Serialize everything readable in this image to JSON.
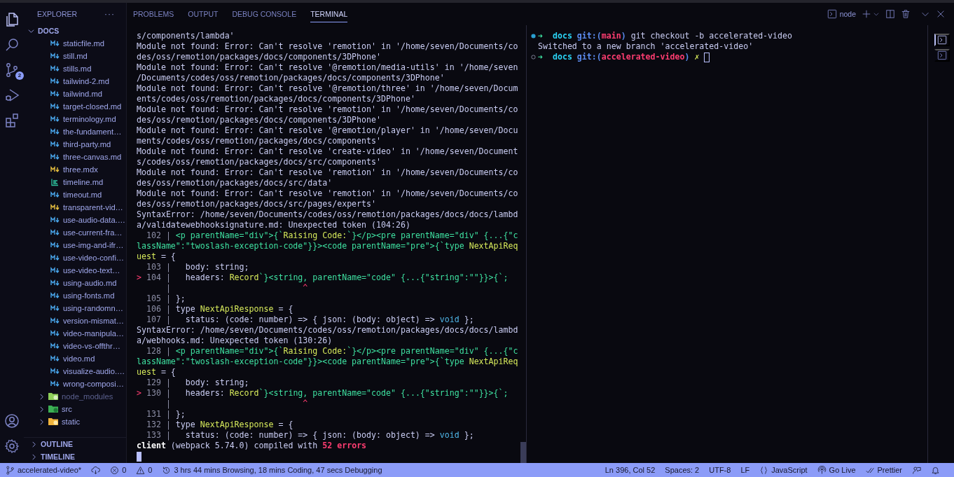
{
  "activity_bar": {
    "items": [
      {
        "kind": "files",
        "selected": true
      },
      {
        "kind": "search",
        "selected": false
      },
      {
        "kind": "source-control",
        "selected": false,
        "badge": "2"
      },
      {
        "kind": "run-debug",
        "selected": false
      },
      {
        "kind": "extensions",
        "selected": false
      }
    ],
    "bottom": [
      {
        "kind": "account"
      },
      {
        "kind": "settings"
      }
    ]
  },
  "explorer": {
    "title": "EXPLORER",
    "actions": "···",
    "tree": {
      "label": "DOCS",
      "expanded": true,
      "children": [
        {
          "kind": "md",
          "label": "staticfile.md"
        },
        {
          "kind": "md",
          "label": "still.md"
        },
        {
          "kind": "md",
          "label": "stills.md"
        },
        {
          "kind": "md",
          "label": "tailwind-2.md"
        },
        {
          "kind": "md",
          "label": "tailwind.md"
        },
        {
          "kind": "md",
          "label": "target-closed.md"
        },
        {
          "kind": "md",
          "label": "terminology.md"
        },
        {
          "kind": "md",
          "label": "the-fundament…"
        },
        {
          "kind": "md",
          "label": "third-party.md"
        },
        {
          "kind": "md",
          "label": "three-canvas.md"
        },
        {
          "kind": "mdx",
          "label": "three.mdx"
        },
        {
          "kind": "timeline",
          "label": "timeline.md"
        },
        {
          "kind": "md",
          "label": "timeout.md"
        },
        {
          "kind": "mdx",
          "label": "transparent-vid…"
        },
        {
          "kind": "md",
          "label": "use-audio-data.…"
        },
        {
          "kind": "md",
          "label": "use-current-fra…"
        },
        {
          "kind": "md",
          "label": "use-img-and-ifr…"
        },
        {
          "kind": "md",
          "label": "use-video-confi…"
        },
        {
          "kind": "md",
          "label": "use-video-text…"
        },
        {
          "kind": "md",
          "label": "using-audio.md"
        },
        {
          "kind": "md",
          "label": "using-fonts.md"
        },
        {
          "kind": "md",
          "label": "using-randomn…"
        },
        {
          "kind": "md",
          "label": "version-mismat…"
        },
        {
          "kind": "md",
          "label": "video-manipula…"
        },
        {
          "kind": "md",
          "label": "video-vs-offthr…"
        },
        {
          "kind": "md",
          "label": "video.md"
        },
        {
          "kind": "md",
          "label": "visualize-audio.…"
        },
        {
          "kind": "md",
          "label": "wrong-composi…"
        },
        {
          "kind": "folder-node",
          "label": "node_modules",
          "expanded": false,
          "dimmed": true
        },
        {
          "kind": "folder-src",
          "label": "src",
          "expanded": false,
          "dimmed": false
        },
        {
          "kind": "folder-static",
          "label": "static",
          "expanded": false,
          "dimmed": false
        }
      ]
    },
    "sections": [
      {
        "label": "OUTLINE",
        "expanded": false
      },
      {
        "label": "TIMELINE",
        "expanded": false
      }
    ]
  },
  "panel": {
    "tabs": [
      {
        "label": "PROBLEMS",
        "selected": false
      },
      {
        "label": "OUTPUT",
        "selected": false
      },
      {
        "label": "DEBUG CONSOLE",
        "selected": false
      },
      {
        "label": "TERMINAL",
        "selected": true
      }
    ],
    "terminal_name": "node",
    "left_terminal": {
      "cursor": true,
      "lines": [
        {
          "segments": [
            {
              "text": "s/components/lambda'",
              "kind": "plain"
            }
          ]
        },
        {
          "segments": [
            {
              "text": "Module not found: Error: Can't resolve 'remotion' in '/home/seven/Documents/co",
              "kind": "plain"
            }
          ]
        },
        {
          "segments": [
            {
              "text": "des/oss/remotion/packages/docs/components/3DPhone'",
              "kind": "plain"
            }
          ]
        },
        {
          "segments": [
            {
              "text": "Module not found: Error: Can't resolve '@remotion/media-utils' in '/home/seven",
              "kind": "plain"
            }
          ]
        },
        {
          "segments": [
            {
              "text": "/Documents/codes/oss/remotion/packages/docs/components/3DPhone'",
              "kind": "plain"
            }
          ]
        },
        {
          "segments": [
            {
              "text": "Module not found: Error: Can't resolve '@remotion/three' in '/home/seven/Docum",
              "kind": "plain"
            }
          ]
        },
        {
          "segments": [
            {
              "text": "ents/codes/oss/remotion/packages/docs/components/3DPhone'",
              "kind": "plain"
            }
          ]
        },
        {
          "segments": [
            {
              "text": "Module not found: Error: Can't resolve 'remotion' in '/home/seven/Documents/co",
              "kind": "plain"
            }
          ]
        },
        {
          "segments": [
            {
              "text": "des/oss/remotion/packages/docs/components/3DPhone'",
              "kind": "plain"
            }
          ]
        },
        {
          "segments": [
            {
              "text": "Module not found: Error: Can't resolve '@remotion/player' in '/home/seven/Docu",
              "kind": "plain"
            }
          ]
        },
        {
          "segments": [
            {
              "text": "ments/codes/oss/remotion/packages/docs/components'",
              "kind": "plain"
            }
          ]
        },
        {
          "segments": [
            {
              "text": "Module not found: Error: Can't resolve 'create-video' in '/home/seven/Document",
              "kind": "plain"
            }
          ]
        },
        {
          "segments": [
            {
              "text": "s/codes/oss/remotion/packages/docs/src/components'",
              "kind": "plain"
            }
          ]
        },
        {
          "segments": [
            {
              "text": "Module not found: Error: Can't resolve 'remotion' in '/home/seven/Documents/co",
              "kind": "plain"
            }
          ]
        },
        {
          "segments": [
            {
              "text": "des/oss/remotion/packages/docs/src/data'",
              "kind": "plain"
            }
          ]
        },
        {
          "segments": [
            {
              "text": "Module not found: Error: Can't resolve 'remotion' in '/home/seven/Documents/co",
              "kind": "plain"
            }
          ]
        },
        {
          "segments": [
            {
              "text": "des/oss/remotion/packages/docs/src/pages/experts'",
              "kind": "plain"
            }
          ]
        },
        {
          "segments": [
            {
              "text": "SyntaxError: /home/seven/Documents/codes/oss/remotion/packages/docs/docs/lambd",
              "kind": "plain"
            }
          ]
        },
        {
          "segments": [
            {
              "text": "a/validatewebhooksignature.md: Unexpected token (104:26)",
              "kind": "plain"
            }
          ]
        },
        {
          "segments": [
            {
              "text": "  102 | ",
              "kind": "num"
            },
            {
              "text": "<p parentName=\"div\">{`",
              "kind": "green"
            },
            {
              "text": "Raising Code:",
              "kind": "yellow"
            },
            {
              "text": "`}</p><pre parentName=\"div\" {...{\"c",
              "kind": "green"
            }
          ]
        },
        {
          "segments": [
            {
              "text": "lassName\":\"twoslash-exception-code\"}}><code parentName=\"pre\">{`type ",
              "kind": "green"
            },
            {
              "text": "NextApiReq",
              "kind": "yellow"
            }
          ]
        },
        {
          "segments": [
            {
              "text": "uest",
              "kind": "yellow"
            },
            {
              "text": " = {",
              "kind": "plain"
            }
          ]
        },
        {
          "segments": [
            {
              "text": "  103 | ",
              "kind": "num"
            },
            {
              "text": "  body: string;",
              "kind": "plain"
            }
          ]
        },
        {
          "segments": [
            {
              "text": ">",
              "kind": "red"
            },
            {
              "text": " 104 | ",
              "kind": "num"
            },
            {
              "text": "  headers: ",
              "kind": "plain"
            },
            {
              "text": "Record",
              "kind": "yellow"
            },
            {
              "text": "`}<string, parentName=\"code\" {...{\"string\":\"\"}}>{`;",
              "kind": "green"
            }
          ]
        },
        {
          "segments": [
            {
              "text": "      |",
              "kind": "num"
            },
            {
              "text": "                           ^",
              "kind": "red"
            }
          ]
        },
        {
          "segments": [
            {
              "text": "  105 | ",
              "kind": "num"
            },
            {
              "text": "};",
              "kind": "plain"
            }
          ]
        },
        {
          "segments": [
            {
              "text": "  106 | ",
              "kind": "num"
            },
            {
              "text": "type ",
              "kind": "plain"
            },
            {
              "text": "NextApiResponse",
              "kind": "yellow"
            },
            {
              "text": " = {",
              "kind": "plain"
            }
          ]
        },
        {
          "segments": [
            {
              "text": "  107 | ",
              "kind": "num"
            },
            {
              "text": "  status: (code: number) => { json: (body: object) => ",
              "kind": "plain"
            },
            {
              "text": "void",
              "kind": "teal"
            },
            {
              "text": " };",
              "kind": "plain"
            }
          ]
        },
        {
          "segments": [
            {
              "text": "SyntaxError: /home/seven/Documents/codes/oss/remotion/packages/docs/docs/lambd",
              "kind": "plain"
            }
          ]
        },
        {
          "segments": [
            {
              "text": "a/webhooks.md: Unexpected token (130:26)",
              "kind": "plain"
            }
          ]
        },
        {
          "segments": [
            {
              "text": "  128 | ",
              "kind": "num"
            },
            {
              "text": "<p parentName=\"div\">{`",
              "kind": "green"
            },
            {
              "text": "Raising Code:",
              "kind": "yellow"
            },
            {
              "text": "`}</p><pre parentName=\"div\" {...{\"c",
              "kind": "green"
            }
          ]
        },
        {
          "segments": [
            {
              "text": "lassName\":\"twoslash-exception-code\"}}><code parentName=\"pre\">{`type ",
              "kind": "green"
            },
            {
              "text": "NextApiReq",
              "kind": "yellow"
            }
          ]
        },
        {
          "segments": [
            {
              "text": "uest",
              "kind": "yellow"
            },
            {
              "text": " = {",
              "kind": "plain"
            }
          ]
        },
        {
          "segments": [
            {
              "text": "  129 | ",
              "kind": "num"
            },
            {
              "text": "  body: string;",
              "kind": "plain"
            }
          ]
        },
        {
          "segments": [
            {
              "text": ">",
              "kind": "red"
            },
            {
              "text": " 130 | ",
              "kind": "num"
            },
            {
              "text": "  headers: ",
              "kind": "plain"
            },
            {
              "text": "Record",
              "kind": "yellow"
            },
            {
              "text": "`}<string, parentName=\"code\" {...{\"string\":\"\"}}>{`;",
              "kind": "green"
            }
          ]
        },
        {
          "segments": [
            {
              "text": "      |",
              "kind": "num"
            },
            {
              "text": "                           ^",
              "kind": "red"
            }
          ]
        },
        {
          "segments": [
            {
              "text": "  131 | ",
              "kind": "num"
            },
            {
              "text": "};",
              "kind": "plain"
            }
          ]
        },
        {
          "segments": [
            {
              "text": "  132 | ",
              "kind": "num"
            },
            {
              "text": "type ",
              "kind": "plain"
            },
            {
              "text": "NextApiResponse",
              "kind": "yellow"
            },
            {
              "text": " = {",
              "kind": "plain"
            }
          ]
        },
        {
          "segments": [
            {
              "text": "  133 | ",
              "kind": "num"
            },
            {
              "text": "  status: (code: number) => { json: (body: object) => ",
              "kind": "plain"
            },
            {
              "text": "void",
              "kind": "teal"
            },
            {
              "text": " };",
              "kind": "plain"
            }
          ]
        },
        {
          "segments": [
            {
              "text": "client",
              "kind": "bold"
            },
            {
              "text": " (webpack 5.74.0) compiled with ",
              "kind": "plain"
            },
            {
              "text": "52 errors",
              "kind": "bold-red"
            }
          ]
        }
      ]
    },
    "right_terminal": {
      "lines": [
        {
          "kind": "filled",
          "segments": [
            {
              "text": "➜  ",
              "kind": "green"
            },
            {
              "text": "docs ",
              "kind": "cyan"
            },
            {
              "text": "git:(",
              "kind": "blue"
            },
            {
              "text": "main",
              "kind": "pink"
            },
            {
              "text": ")",
              "kind": "blue"
            },
            {
              "text": " git checkout -b accelerated-video",
              "kind": "plain"
            }
          ],
          "cursor": false
        },
        {
          "segments": [
            {
              "text": "Switched to a new branch 'accelerated-video'",
              "kind": "plain"
            }
          ],
          "cursor": false
        },
        {
          "kind": "hollow",
          "segments": [
            {
              "text": "➜  ",
              "kind": "green"
            },
            {
              "text": "docs ",
              "kind": "cyan"
            },
            {
              "text": "git:(",
              "kind": "blue"
            },
            {
              "text": "accelerated-video",
              "kind": "pink"
            },
            {
              "text": ")",
              "kind": "blue"
            },
            {
              "text": " ✗ ",
              "kind": "yellow"
            }
          ],
          "cursor": true
        }
      ]
    },
    "terminal_list": [
      {
        "selected": true
      },
      {
        "selected": false
      }
    ]
  },
  "status_bar": {
    "left": [
      {
        "kind": "branch",
        "text": "accelerated-video*"
      },
      {
        "kind": "sync"
      },
      {
        "kind": "errors",
        "text": "0"
      },
      {
        "kind": "warnings",
        "text": "0"
      },
      {
        "kind": "history",
        "text": "3 hrs 44 mins Browsing, 18 mins Coding, 47 secs Debugging"
      }
    ],
    "right": [
      {
        "kind": "text",
        "text": "Ln 396, Col 52"
      },
      {
        "kind": "text",
        "text": "Spaces: 2"
      },
      {
        "kind": "text",
        "text": "UTF-8"
      },
      {
        "kind": "text",
        "text": "LF"
      },
      {
        "kind": "language",
        "text": "JavaScript"
      },
      {
        "kind": "golive",
        "text": "Go Live"
      },
      {
        "kind": "prettier",
        "text": "Prettier"
      },
      {
        "kind": "feedback"
      },
      {
        "kind": "bell"
      }
    ]
  }
}
